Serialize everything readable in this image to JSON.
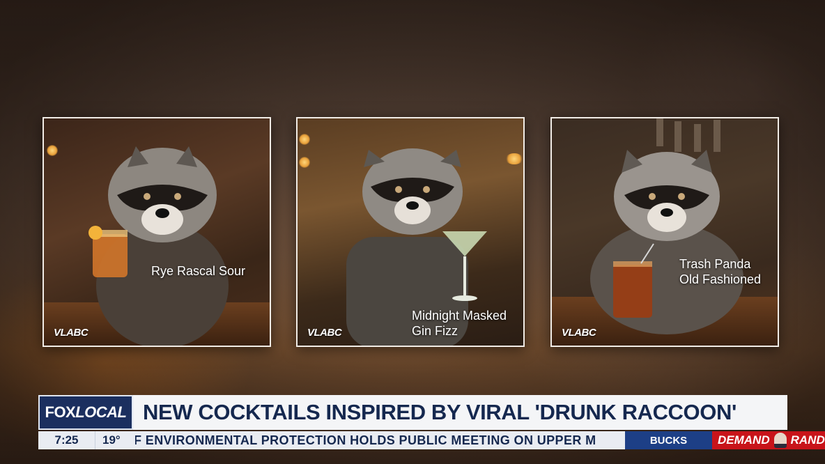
{
  "cards": [
    {
      "caption_lines": [
        "Rye Rascal Sour"
      ],
      "logo": "VLABC"
    },
    {
      "caption_lines": [
        "Midnight Masked",
        "Gin Fizz"
      ],
      "logo": "VLABC"
    },
    {
      "caption_lines": [
        "Trash Panda",
        "Old Fashioned"
      ],
      "logo": "VLABC"
    }
  ],
  "lower_third": {
    "bug_fox": "FOX",
    "bug_local": "LOCAL",
    "headline": "NEW COCKTAILS INSPIRED BY VIRAL 'DRUNK RACCOON'",
    "time": "7:25",
    "temperature": "19°",
    "ticker": "F ENVIRONMENTAL PROTECTION HOLDS PUBLIC MEETING ON UPPER M",
    "sports": "BUCKS",
    "promo_left": "DEMAND",
    "promo_right": "RAND"
  },
  "colors": {
    "network_blue": "#1b2f5f",
    "headline_text": "#15284f",
    "promo_red": "#c8141a"
  }
}
